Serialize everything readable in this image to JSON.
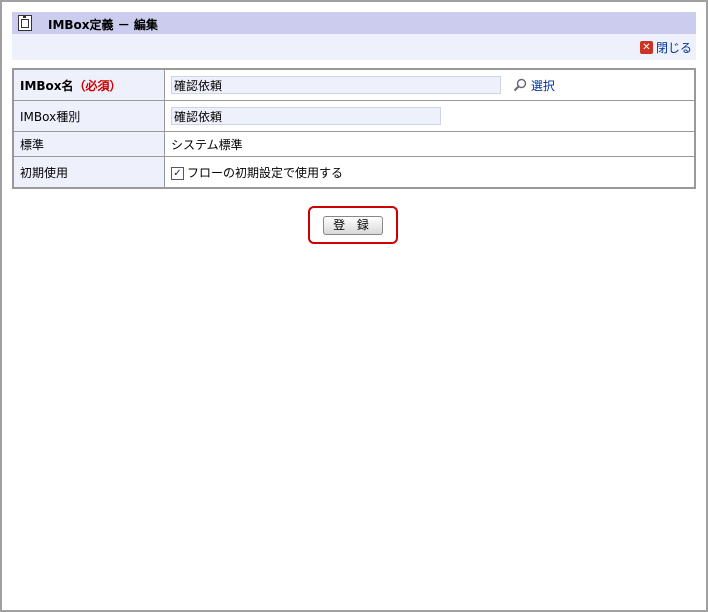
{
  "dialog": {
    "title": "IMBox定義 － 編集",
    "close_label": "閉じる"
  },
  "form": {
    "name": {
      "label": "IMBox名",
      "required_label": "（必須）",
      "value": "確認依頼",
      "select_label": "選択"
    },
    "type": {
      "label": "IMBox種別",
      "value": "確認依頼"
    },
    "standard": {
      "label": "標準",
      "value": "システム標準"
    },
    "initial_use": {
      "label": "初期使用",
      "checkbox_label": "フローの初期設定で使用する",
      "checked": true
    }
  },
  "actions": {
    "register_label": "登 録"
  },
  "icons": {
    "title": "document-icon",
    "close": "close-icon",
    "search": "search-icon"
  }
}
